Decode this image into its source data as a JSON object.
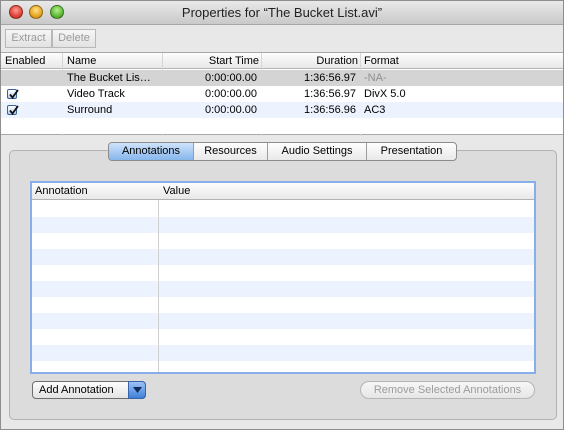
{
  "window": {
    "title": "Properties for “The Bucket List.avi”"
  },
  "toolbar": {
    "extract_label": "Extract",
    "delete_label": "Delete"
  },
  "tracks": {
    "columns": [
      "Enabled",
      "Name",
      "Start Time",
      "Duration",
      "Format"
    ],
    "rows": [
      {
        "enabled": null,
        "name": "The Bucket Lis…",
        "start": "0:00:00.00",
        "duration": "1:36:56.97",
        "format": "-NA-"
      },
      {
        "enabled": true,
        "name": "Video Track",
        "start": "0:00:00.00",
        "duration": "1:36:56.97",
        "format": "DivX 5.0"
      },
      {
        "enabled": true,
        "name": "Surround",
        "start": "0:00:00.00",
        "duration": "1:36:56.96",
        "format": "AC3"
      }
    ]
  },
  "tabs": [
    {
      "label": "Annotations",
      "active": true
    },
    {
      "label": "Resources",
      "active": false
    },
    {
      "label": "Audio Settings",
      "active": false
    },
    {
      "label": "Presentation",
      "active": false
    }
  ],
  "annotations": {
    "columns": [
      "Annotation",
      "Value"
    ],
    "rows": []
  },
  "buttons": {
    "add_annotation": "Add Annotation",
    "remove_selected": "Remove Selected Annotations"
  },
  "icons": {
    "close": "close-icon",
    "minimize": "minimize-icon",
    "zoom": "zoom-icon",
    "checkbox": "checkbox-checked-icon",
    "dropdown": "chevron-down-icon"
  },
  "colors": {
    "selected_tab": "#86b6ec",
    "focus_ring": "#86aeea",
    "row_stripe": "#edf3fe",
    "selected_row": "#d4d4d4"
  }
}
